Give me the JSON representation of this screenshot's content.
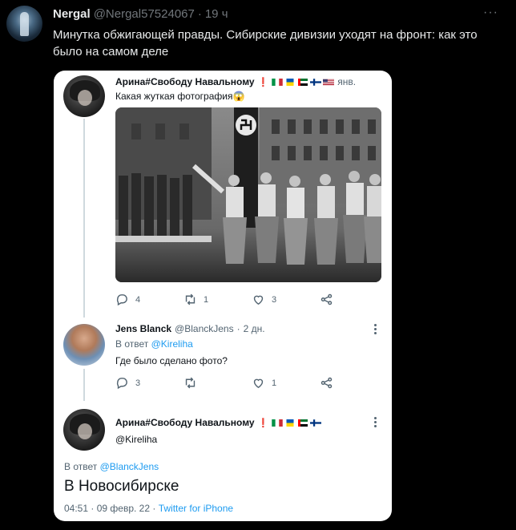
{
  "outer_tweet": {
    "author_name": "Nergal",
    "author_handle": "@Nergal57524067",
    "separator": "·",
    "time": "19 ч",
    "more": "···",
    "text": "Минутка обжигающей правды. Сибирские дивизии уходят на фронт: как это было на самом деле"
  },
  "embedded": {
    "tweet1": {
      "name": "Арина#Свободу Навальному",
      "exclamation": "❗",
      "date": "янв.",
      "text": "Какая жуткая фотография",
      "emoji": "😱",
      "replies": "4",
      "retweets": "1",
      "likes": "3"
    },
    "tweet2": {
      "name": "Jens Blanck",
      "handle": "@BlanckJens",
      "separator": "·",
      "time": "2 дн.",
      "reply_prefix": "В ответ",
      "reply_to": "@Kireliha",
      "text": "Где было сделано фото?",
      "replies": "3",
      "retweets": "",
      "likes": "1"
    },
    "tweet3": {
      "name": "Арина#Свободу Навальному",
      "exclamation": "❗",
      "handle": "@Kireliha",
      "reply_prefix": "В ответ",
      "reply_to": "@BlanckJens",
      "text": "В Новосибирске",
      "time": "04:51",
      "separator1": "·",
      "date": "09 февр. 22",
      "separator2": "·",
      "source": "Twitter for iPhone"
    }
  },
  "colors": {
    "background": "#000000",
    "card": "#ffffff",
    "link": "#1d9bf0",
    "muted": "#71767b",
    "exclamation": "#e0245e"
  },
  "icons": [
    "reply-icon",
    "retweet-icon",
    "like-icon",
    "share-icon",
    "more-icon"
  ]
}
